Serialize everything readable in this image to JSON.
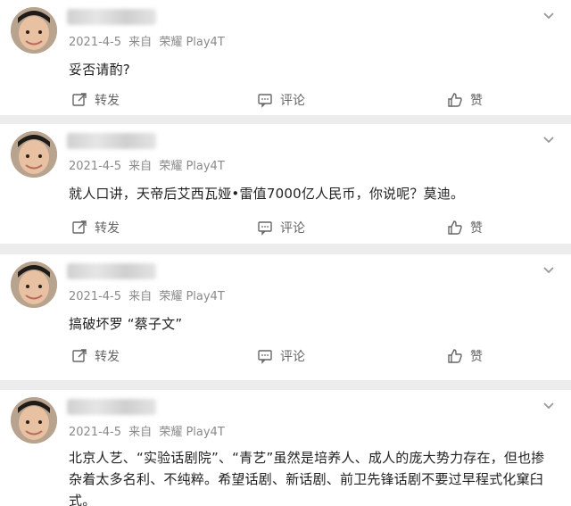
{
  "posts": [
    {
      "meta": {
        "date": "2021-4-5",
        "via": "来自",
        "device": "荣耀 Play4T"
      },
      "content": "妥否请酌?",
      "actions": {
        "share": "转发",
        "comment": "评论",
        "like": "赞"
      }
    },
    {
      "meta": {
        "date": "2021-4-5",
        "via": "来自",
        "device": "荣耀 Play4T"
      },
      "content": "就人口讲，天帝后艾西瓦娅•雷值7000亿人民币，你说呢？莫迪。",
      "actions": {
        "share": "转发",
        "comment": "评论",
        "like": "赞"
      }
    },
    {
      "meta": {
        "date": "2021-4-5",
        "via": "来自",
        "device": "荣耀 Play4T"
      },
      "content": "搞破坏罗 “蔡子文”",
      "actions": {
        "share": "转发",
        "comment": "评论",
        "like": "赞"
      }
    },
    {
      "meta": {
        "date": "2021-4-5",
        "via": "来自",
        "device": "荣耀 Play4T"
      },
      "content": "北京人艺、“实验话剧院”、“青艺”虽然是培养人、成人的庞大势力存在，但也掺杂着太多名利、不纯粹。希望话剧、新话剧、前卫先锋话剧不要过早程式化窠臼式。",
      "actions": null
    }
  ],
  "icons": {
    "share": "share-icon",
    "comment": "comment-icon",
    "like": "thumbs-up-icon",
    "menu": "chevron-down-icon"
  },
  "colors": {
    "meta": "#8a8a8a",
    "text": "#222222",
    "divider": "#ececec",
    "action": "#666666"
  }
}
